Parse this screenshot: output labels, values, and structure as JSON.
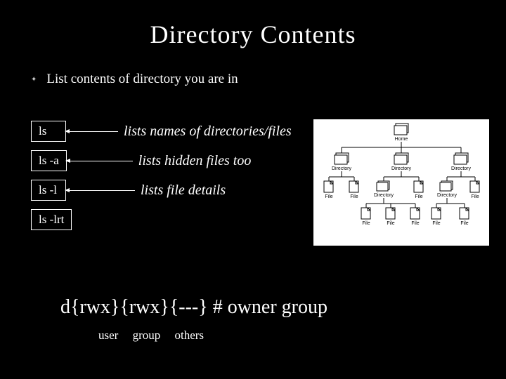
{
  "title": "Directory Contents",
  "bullet": "List contents of directory you are in",
  "cmds": [
    {
      "cmd": "ls",
      "desc": "lists names of directories/files"
    },
    {
      "cmd": "ls -a",
      "desc": "lists hidden files too"
    },
    {
      "cmd": "ls -l",
      "desc": "lists file details"
    },
    {
      "cmd": "ls -lrt",
      "desc": ""
    }
  ],
  "perm_line": "d{rwx}{rwx}{---}  #  owner group",
  "perm_labels": {
    "user": "user",
    "group": "group",
    "others": "others"
  },
  "tree": {
    "root": "Home",
    "level1": [
      "Directory",
      "Directory",
      "Directory"
    ],
    "level2": [
      "File",
      "File",
      "Directory",
      "File",
      "Directory",
      "File"
    ],
    "level3": [
      "File",
      "File",
      "File",
      "File",
      "File"
    ]
  }
}
